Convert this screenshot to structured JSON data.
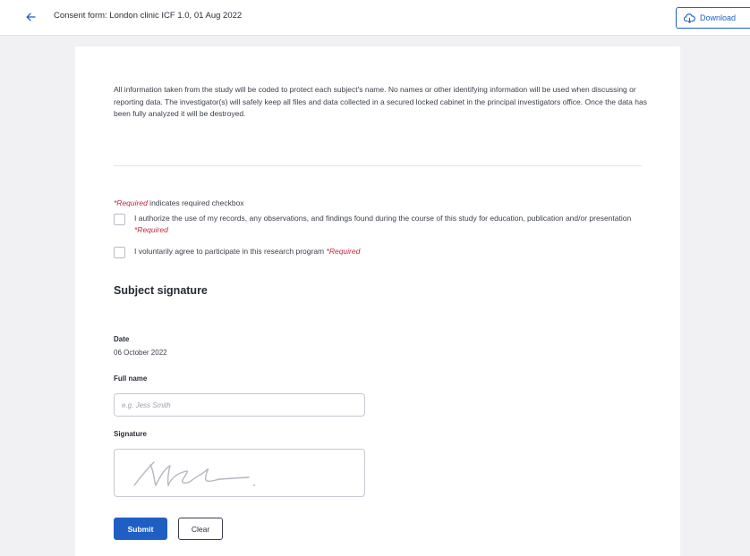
{
  "header": {
    "title": "Consent form: London clinic ICF 1.0, 01 Aug 2022",
    "back_icon": "arrow-left-icon",
    "download_label": "Download",
    "download_icon": "cloud-download-icon",
    "accent_color": "#1f5fc4"
  },
  "form": {
    "intro_text": "All information taken from the study will be coded to protect each subject's name. No names or other identifying information will be used when discussing or reporting data. The investigator(s) will safely keep all files and data collected in a secured locked cabinet in the principal investigators office. Once the data has been fully analyzed it will be destroyed.",
    "required_note": {
      "marker": "*Required",
      "text": " indicates required checkbox"
    },
    "checkboxes": [
      {
        "label": "I authorize the use of my records, any observations, and findings found during the course of this study for education, publication and/or presentation",
        "required_marker": "*Required",
        "checked": false
      },
      {
        "label": "I voluntarily agree to participate in this research program",
        "required_marker": "*Required",
        "checked": false
      }
    ],
    "section_title": "Subject signature",
    "date": {
      "label": "Date",
      "value": "06 October 2022"
    },
    "full_name": {
      "label": "Full name",
      "placeholder": "e.g. Jess Smith",
      "value": ""
    },
    "signature": {
      "label": "Signature"
    },
    "buttons": {
      "submit": "Submit",
      "clear": "Clear"
    },
    "required_color": "#c0283f"
  }
}
